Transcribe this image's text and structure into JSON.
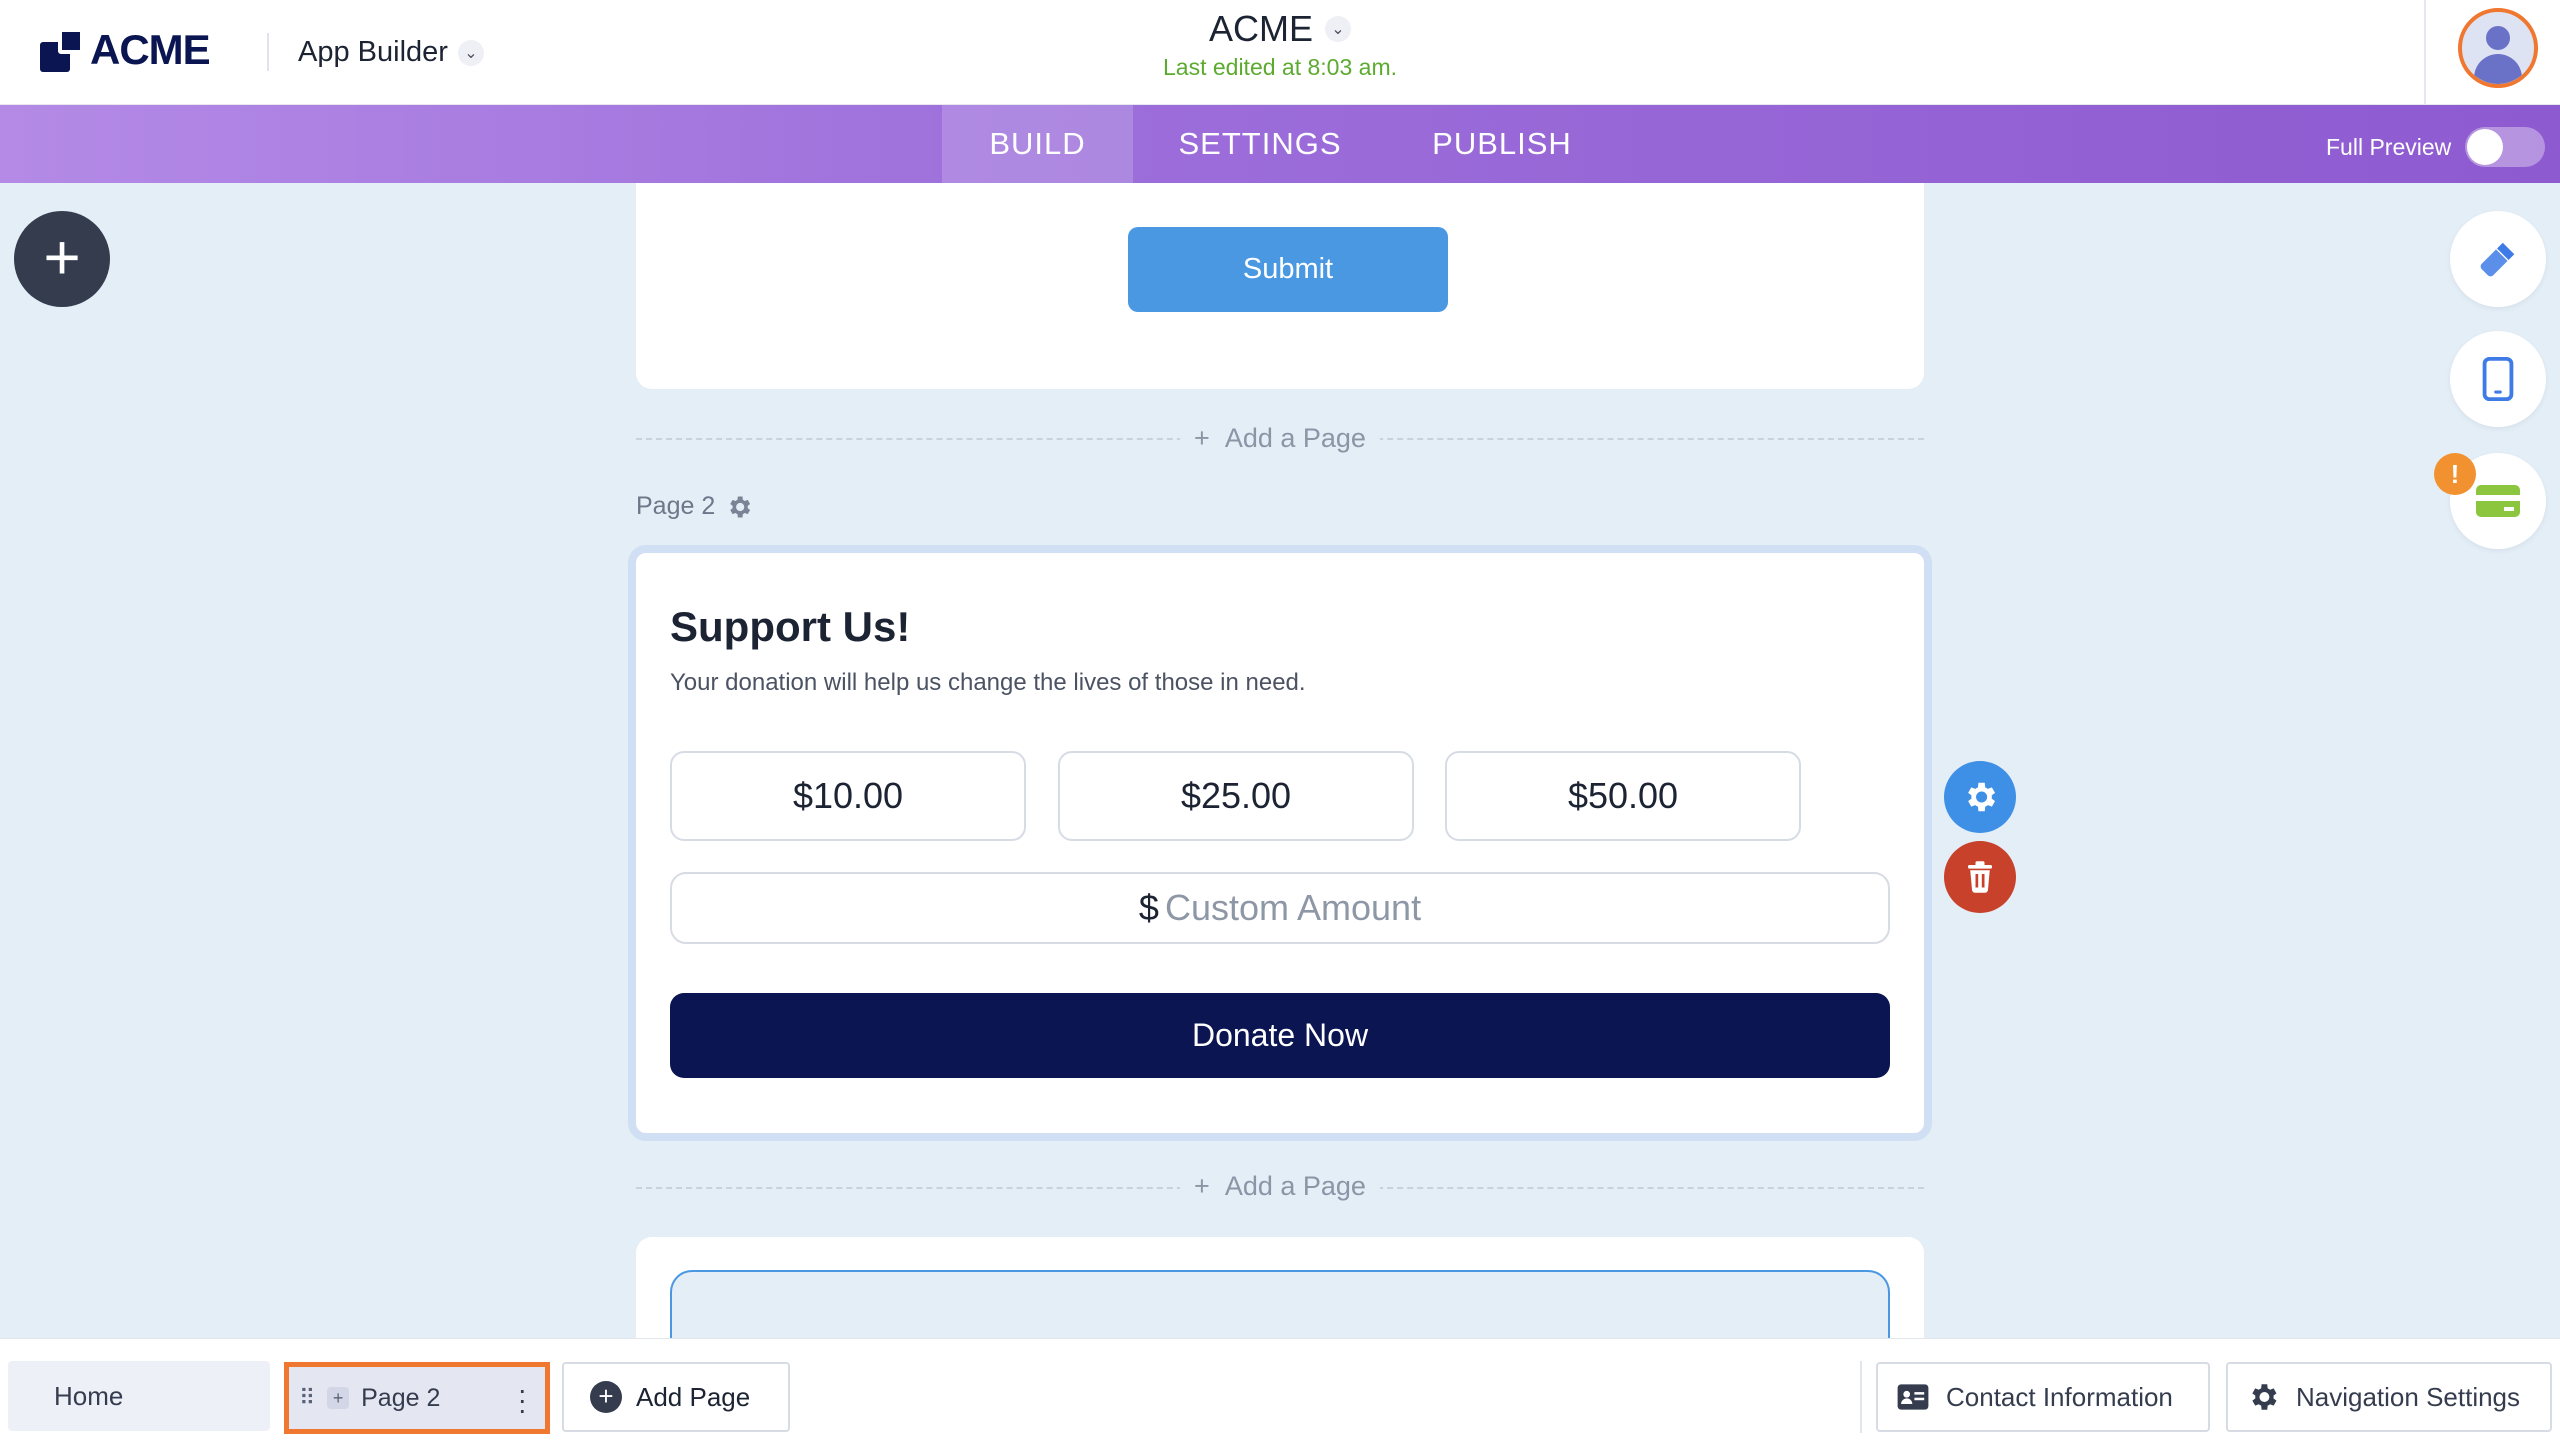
{
  "header": {
    "logo_text": "ACME",
    "app_builder_label": "App Builder",
    "form_title": "ACME",
    "last_edited": "Last edited at 8:03 am."
  },
  "tabs": [
    {
      "label": "BUILD",
      "active": true
    },
    {
      "label": "SETTINGS",
      "active": false
    },
    {
      "label": "PUBLISH",
      "active": false
    }
  ],
  "full_preview": {
    "label": "Full Preview",
    "enabled": false
  },
  "canvas": {
    "submit_label": "Submit",
    "add_page_label": "Add a Page",
    "page_label": "Page 2",
    "donation": {
      "title": "Support Us!",
      "subtitle": "Your donation will help us change the lives of those in need.",
      "amounts": [
        "$10.00",
        "$25.00",
        "$50.00"
      ],
      "currency_symbol": "$",
      "custom_placeholder": "Custom Amount",
      "donate_label": "Donate Now"
    }
  },
  "tools": {
    "warning_badge": "!"
  },
  "bottom_bar": {
    "pages": [
      "Home",
      "Page 2"
    ],
    "add_page_label": "Add Page",
    "contact_label": "Contact Information",
    "nav_settings_label": "Navigation Settings"
  },
  "colors": {
    "brand_navy": "#0a1551",
    "accent_orange": "#f0772f",
    "submit_blue": "#4a98e2",
    "edited_green": "#5cab30",
    "trash_red": "#c8412a"
  }
}
